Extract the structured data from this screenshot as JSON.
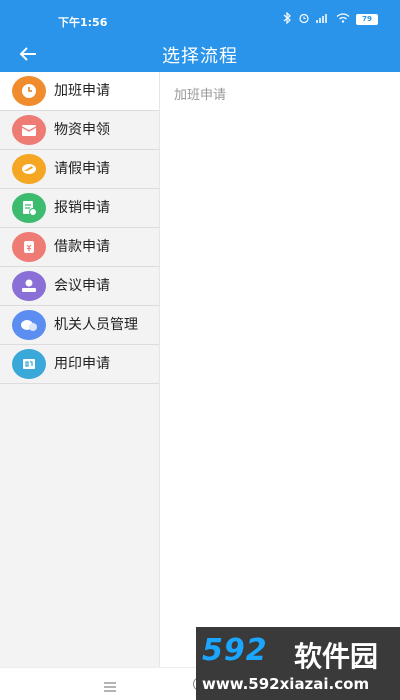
{
  "status": {
    "time": "下午1:56",
    "battery": "79"
  },
  "header": {
    "title": "选择流程"
  },
  "sidebar": {
    "items": [
      {
        "label": "加班申请",
        "icon": "clock-icon",
        "color": "#f08c2e",
        "active": true
      },
      {
        "label": "物资申领",
        "icon": "package-icon",
        "color": "#ee7c74"
      },
      {
        "label": "请假申请",
        "icon": "plane-icon",
        "color": "#f5a623"
      },
      {
        "label": "报销申请",
        "icon": "receipt-icon",
        "color": "#3dbb6f"
      },
      {
        "label": "借款申请",
        "icon": "money-bag-icon",
        "color": "#ee7c74"
      },
      {
        "label": "会议申请",
        "icon": "meeting-icon",
        "color": "#8a6fd6"
      },
      {
        "label": "机关人员管理",
        "icon": "people-icon",
        "color": "#5b8ef0"
      },
      {
        "label": "用印申请",
        "icon": "seal-icon",
        "color": "#3aa8d8"
      }
    ]
  },
  "content": {
    "selected_label": "加班申请"
  },
  "watermark": {
    "logo": "592",
    "text": "软件园",
    "url": "www.592xiazai.com"
  }
}
